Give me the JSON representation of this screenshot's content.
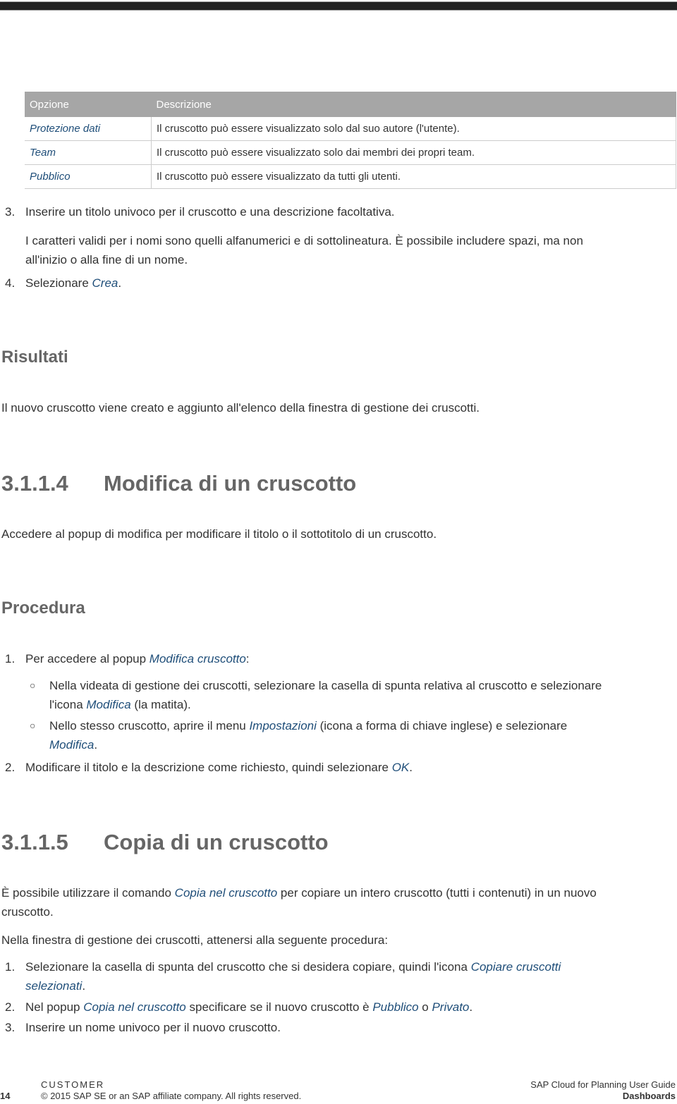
{
  "table": {
    "headers": [
      "Opzione",
      "Descrizione"
    ],
    "rows": [
      {
        "option": "Protezione dati",
        "description": "Il cruscotto può essere visualizzato solo dal suo autore (l'utente)."
      },
      {
        "option": "Team",
        "description": "Il cruscotto può essere visualizzato solo dai membri dei propri team."
      },
      {
        "option": "Pubblico",
        "description": "Il cruscotto può essere visualizzato da tutti gli utenti."
      }
    ]
  },
  "steps_top": {
    "s3_num": "3.",
    "s3_text": "Inserire un titolo univoco per il cruscotto e una descrizione facoltativa.",
    "s3_note_line1": "I caratteri validi per i nomi sono quelli alfanumerici e di sottolineatura. È possibile includere spazi, ma non",
    "s3_note_line2": "all'inizio o alla fine di un nome.",
    "s4_num": "4.",
    "s4_text": "Selezionare ",
    "s4_link": "Crea",
    "s4_end": "."
  },
  "results": {
    "heading": "Risultati",
    "text": "Il nuovo cruscotto viene creato e aggiunto all'elenco della finestra di gestione dei cruscotti."
  },
  "section_314": {
    "number": "3.1.1.4",
    "title": "Modifica di un cruscotto",
    "intro": "Accedere al popup di modifica per modificare il titolo o il sottotitolo di un cruscotto.",
    "procedure_heading": "Procedura",
    "step1_num": "1.",
    "step1_text": "Per accedere al popup ",
    "step1_link": "Modifica cruscotto",
    "step1_end": ":",
    "bullet1_line1": "Nella videata di gestione dei cruscotti, selezionare la casella di spunta relativa al cruscotto e selezionare",
    "bullet1_pre": "l'icona ",
    "bullet1_link": "Modifica",
    "bullet1_end": " (la matita).",
    "bullet2_pre": "Nello stesso cruscotto, aprire il menu ",
    "bullet2_link": "Impostazioni",
    "bullet2_end": " (icona a forma di chiave inglese) e selezionare",
    "bullet2_link2": "Modifica",
    "bullet2_end2": ".",
    "step2_num": "2.",
    "step2_text": "Modificare il titolo e la descrizione come richiesto, quindi selezionare ",
    "step2_link": "OK",
    "step2_end": "."
  },
  "section_315": {
    "number": "3.1.1.5",
    "title": "Copia di un cruscotto",
    "intro_pre": "È possibile utilizzare il comando ",
    "intro_link": "Copia nel cruscotto",
    "intro_end": " per copiare un intero cruscotto (tutti i contenuti) in un nuovo",
    "intro_line2": "cruscotto.",
    "lead": "Nella finestra di gestione dei cruscotti, attenersi alla seguente procedura:",
    "step1_num": "1.",
    "step1_text": "Selezionare la casella di spunta del cruscotto che si desidera copiare, quindi l'icona ",
    "step1_link": "Copiare cruscotti",
    "step1_link2": "selezionati",
    "step1_end": ".",
    "step2_num": "2.",
    "step2_pre": "Nel popup ",
    "step2_link": "Copia nel cruscotto",
    "step2_mid": " specificare se il nuovo cruscotto è ",
    "step2_link2": "Pubblico",
    "step2_mid2": " o ",
    "step2_link3": "Privato",
    "step2_end": ".",
    "step3_num": "3.",
    "step3_text": "Inserire un nome univoco per il nuovo cruscotto."
  },
  "footer": {
    "page_number": "14",
    "classification": "CUSTOMER",
    "copyright": "© 2015 SAP SE or an SAP affiliate company. All rights reserved.",
    "guide_title": "SAP Cloud for Planning User Guide",
    "chapter": "Dashboards"
  }
}
